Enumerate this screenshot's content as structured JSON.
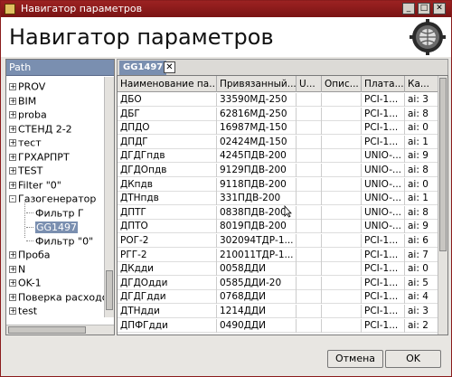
{
  "window": {
    "title": "Навигатор параметров",
    "controls": [
      "minimize",
      "maximize",
      "close"
    ]
  },
  "header": {
    "title": "Навигатор параметров",
    "logo_icon": "gear-globe-icon"
  },
  "left_panel": {
    "header": "Path",
    "tree": [
      {
        "label": "PROV",
        "expander": "+",
        "level": 0
      },
      {
        "label": "BIM",
        "expander": "+",
        "level": 0
      },
      {
        "label": "proba",
        "expander": "+",
        "level": 0
      },
      {
        "label": "СТЕНД 2-2",
        "expander": "+",
        "level": 0
      },
      {
        "label": "тест",
        "expander": "+",
        "level": 0
      },
      {
        "label": "ГРХАРПРТ",
        "expander": "+",
        "level": 0
      },
      {
        "label": "TEST",
        "expander": "+",
        "level": 0
      },
      {
        "label": "Filter \"0\"",
        "expander": "+",
        "level": 0
      },
      {
        "label": "Газогенератор",
        "expander": "-",
        "level": 0
      },
      {
        "label": "Фильтр Г",
        "expander": "",
        "level": 1
      },
      {
        "label": "GG1497",
        "expander": "",
        "level": 1,
        "selected": true
      },
      {
        "label": "Фильтр \"0\"",
        "expander": "",
        "level": 1
      },
      {
        "label": "Проба",
        "expander": "+",
        "level": 0
      },
      {
        "label": "N",
        "expander": "+",
        "level": 0
      },
      {
        "label": "OK-1",
        "expander": "+",
        "level": 0
      },
      {
        "label": "Поверка расходо",
        "expander": "+",
        "level": 0
      },
      {
        "label": "test",
        "expander": "+",
        "level": 0
      }
    ]
  },
  "tab": {
    "label": "GG1497",
    "close_glyph": "✕"
  },
  "table": {
    "columns": [
      "Наименование па...",
      "Привязанный...",
      "U...",
      "Опис...",
      "Плата...",
      "Ка..."
    ],
    "rows": [
      [
        "ДБО",
        "33590МД-250",
        "",
        "",
        "PCI-1...",
        "ai: 3"
      ],
      [
        "ДБГ",
        "62816МД-250",
        "",
        "",
        "PCI-1...",
        "ai: 8"
      ],
      [
        "ДПДО",
        "16987МД-150",
        "",
        "",
        "PCI-1...",
        "ai: 0"
      ],
      [
        "ДПДГ",
        "02424МД-150",
        "",
        "",
        "PCI-1...",
        "ai: 1"
      ],
      [
        "ДГДГпдв",
        "4245ПДВ-200",
        "",
        "",
        "UNIO-...",
        "ai: 9"
      ],
      [
        "ДГДОпдв",
        "9129ПДВ-200",
        "",
        "",
        "UNIO-...",
        "ai: 8"
      ],
      [
        "ДКпдв",
        "9118ПДВ-200",
        "",
        "",
        "UNIO-...",
        "ai: 0"
      ],
      [
        "ДТНпдв",
        "331ПДВ-200",
        "",
        "",
        "UNIO-...",
        "ai: 1"
      ],
      [
        "ДПТГ",
        "0838ПДВ-200",
        "",
        "",
        "UNIO-...",
        "ai: 8"
      ],
      [
        "ДПТО",
        "8019ПДВ-200",
        "",
        "",
        "UNIO-...",
        "ai: 9"
      ],
      [
        "РОГ-2",
        "302094ТДР-1...",
        "",
        "",
        "PCI-1...",
        "ai: 6"
      ],
      [
        "РГГ-2",
        "210011ТДР-1...",
        "",
        "",
        "PCI-1...",
        "ai: 7"
      ],
      [
        "ДКдди",
        "0058ДДИ",
        "",
        "",
        "PCI-1...",
        "ai: 0"
      ],
      [
        "ДГДОдди",
        "0585ДДИ-20",
        "",
        "",
        "PCI-1...",
        "ai: 5"
      ],
      [
        "ДГДГдди",
        "0768ДДИ",
        "",
        "",
        "PCI-1...",
        "ai: 4"
      ],
      [
        "ДТНдди",
        "1214ДДИ",
        "",
        "",
        "PCI-1...",
        "ai: 3"
      ],
      [
        "ДПФГдди",
        "0490ДДИ",
        "",
        "",
        "PCI-1...",
        "ai: 2"
      ]
    ]
  },
  "buttons": {
    "cancel": "Отмена",
    "ok": "OK"
  }
}
